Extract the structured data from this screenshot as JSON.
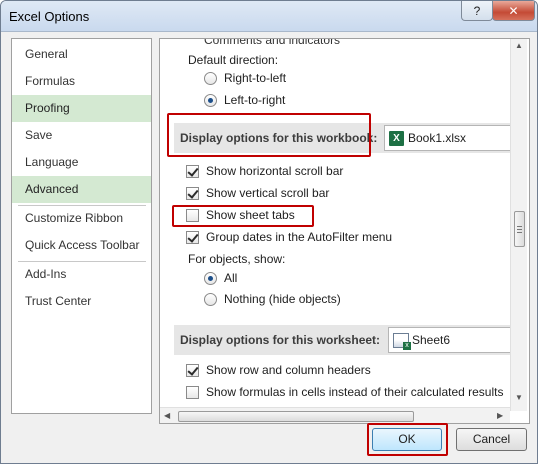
{
  "window": {
    "title": "Excel Options",
    "help_label": "?",
    "close_label": "✕"
  },
  "nav": {
    "items": [
      {
        "label": "General",
        "selected": false
      },
      {
        "label": "Formulas",
        "selected": false
      },
      {
        "label": "Proofing",
        "selected": true
      },
      {
        "label": "Save",
        "selected": false
      },
      {
        "label": "Language",
        "selected": false
      },
      {
        "label": "Advanced",
        "selected": true
      },
      {
        "label": "Customize Ribbon",
        "selected": false
      },
      {
        "label": "Quick Access Toolbar",
        "selected": false
      },
      {
        "label": "Add-Ins",
        "selected": false
      },
      {
        "label": "Trust Center",
        "selected": false
      }
    ]
  },
  "content": {
    "cut_top_label": "Comments and indicators",
    "default_direction_label": "Default direction:",
    "rtl_label": "Right-to-left",
    "ltr_label": "Left-to-right",
    "workbook_section_label": "Display options for this workbook:",
    "workbook_combo_value": "Book1.xlsx",
    "horizontal_scroll_label": "Show horizontal scroll bar",
    "vertical_scroll_label": "Show vertical scroll bar",
    "sheet_tabs_label": "Show sheet tabs",
    "group_dates_label": "Group dates in the AutoFilter menu",
    "for_objects_label": "For objects, show:",
    "all_label": "All",
    "nothing_label": "Nothing (hide objects)",
    "worksheet_section_label": "Display options for this worksheet:",
    "worksheet_combo_value": "Sheet6",
    "row_col_headers_label": "Show row and column headers",
    "formulas_label": "Show formulas in cells instead of their calculated results"
  },
  "buttons": {
    "ok_label": "OK",
    "cancel_label": "Cancel"
  },
  "state": {
    "rtl_selected": false,
    "ltr_selected": true,
    "horizontal_scroll_checked": true,
    "vertical_scroll_checked": true,
    "sheet_tabs_checked": false,
    "group_dates_checked": true,
    "all_selected": true,
    "nothing_selected": false,
    "row_col_headers_checked": true,
    "formulas_checked": false
  },
  "colors": {
    "highlight": "#c00000",
    "nav_selected": "#d4e9d2",
    "excel_green": "#1d7044"
  }
}
